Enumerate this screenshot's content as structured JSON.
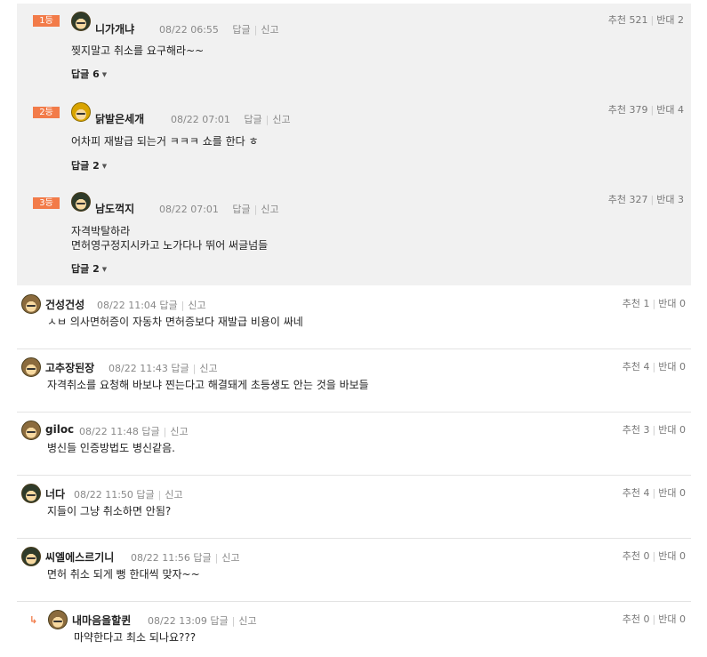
{
  "best": [
    {
      "rank": "1등",
      "nick": "니가개냐",
      "date": "08/22 06:55",
      "reply": "답글",
      "report": "신고",
      "up_label": "추천",
      "up": "521",
      "down_label": "반대",
      "down": "2",
      "lines": [
        "찢지말고 취소를 요구해라~~"
      ],
      "replies_label": "답글",
      "replies": "6"
    },
    {
      "rank": "2등",
      "nick": "닭발은세개",
      "date": "08/22 07:01",
      "reply": "답글",
      "report": "신고",
      "up_label": "추천",
      "up": "379",
      "down_label": "반대",
      "down": "4",
      "lines": [
        "어차피 재발급 되는거 ㅋㅋㅋ 쇼를 한다 ㅎ"
      ],
      "replies_label": "답글",
      "replies": "2"
    },
    {
      "rank": "3등",
      "nick": "남도꺽지",
      "date": "08/22 07:01",
      "reply": "답글",
      "report": "신고",
      "up_label": "추천",
      "up": "327",
      "down_label": "반대",
      "down": "3",
      "lines": [
        "자격박탈하라",
        "면허영구정지시카고 노가다나 뛰어 써글넘들"
      ],
      "replies_label": "답글",
      "replies": "2"
    }
  ],
  "comments": [
    {
      "nick": "건성건성",
      "date": "08/22 11:04",
      "reply": "답글",
      "report": "신고",
      "up_label": "추천",
      "up": "1",
      "down_label": "반대",
      "down": "0",
      "text": "ㅅㅂ 의사면허증이 자동차 면허증보다 재발급 비용이 싸네"
    },
    {
      "nick": "고추장된장",
      "date": "08/22 11:43",
      "reply": "답글",
      "report": "신고",
      "up_label": "추천",
      "up": "4",
      "down_label": "반대",
      "down": "0",
      "text": "자격취소를 요청해 바보냐 찐는다고 해결돼게 초등생도 안는 것을 바보들"
    },
    {
      "nick": "giloc",
      "date": "08/22 11:48",
      "reply": "답글",
      "report": "신고",
      "up_label": "추천",
      "up": "3",
      "down_label": "반대",
      "down": "0",
      "text": "병신들 인증방법도 병신같음."
    },
    {
      "nick": "너다",
      "date": "08/22 11:50",
      "reply": "답글",
      "report": "신고",
      "up_label": "추천",
      "up": "4",
      "down_label": "반대",
      "down": "0",
      "text": "지들이 그냥 취소하면 안됨?"
    },
    {
      "nick": "씨엘에스르기니",
      "date": "08/22 11:56",
      "reply": "답글",
      "report": "신고",
      "up_label": "추천",
      "up": "0",
      "down_label": "반대",
      "down": "0",
      "text": "면허 취소 되게 뻥 한대씩 맞자~~"
    }
  ],
  "reply": {
    "arrow": "↳",
    "nick": "내마음을할퀸",
    "date": "08/22 13:09",
    "reply": "답글",
    "report": "신고",
    "up_label": "추천",
    "up": "0",
    "down_label": "반대",
    "down": "0",
    "text": "마약한다고 최소 되나요???"
  }
}
